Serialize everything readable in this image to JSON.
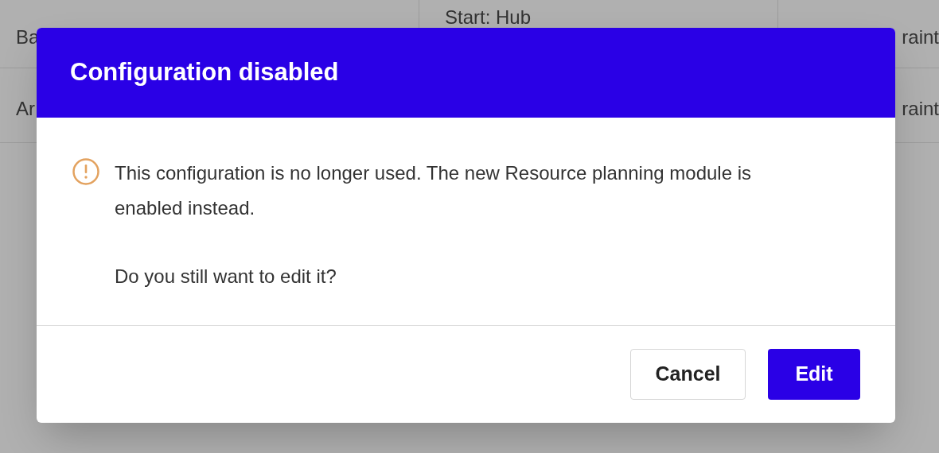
{
  "background_table": {
    "rows": [
      {
        "cells": [
          "Ba",
          "Start: Hub",
          "raint"
        ]
      },
      {
        "cells": [
          "Ar",
          "",
          "raint"
        ]
      }
    ]
  },
  "dialog": {
    "title": "Configuration disabled",
    "message": [
      "This configuration is no longer used. The new Resource planning module is enabled instead.",
      "Do you still want to edit it?"
    ],
    "buttons": [
      {
        "label": "Cancel",
        "kind": "secondary"
      },
      {
        "label": "Edit",
        "kind": "primary"
      }
    ]
  }
}
